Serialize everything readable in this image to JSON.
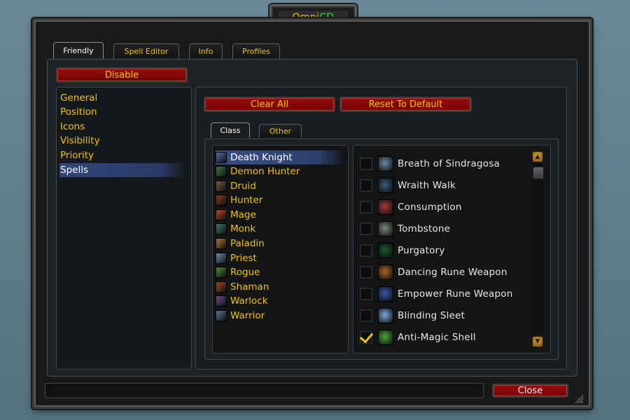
{
  "window": {
    "title_part1": "Omni",
    "title_part2": "CD"
  },
  "top_tabs": [
    {
      "label": "Friendly",
      "active": true
    },
    {
      "label": "Spell Editor",
      "active": false
    },
    {
      "label": "Info",
      "active": false
    },
    {
      "label": "Profiles",
      "active": false
    }
  ],
  "toolbar": {
    "disable_label": "Disable",
    "clear_all_label": "Clear All",
    "reset_label": "Reset To Default",
    "close_label": "Close"
  },
  "nav": {
    "items": [
      {
        "label": "General"
      },
      {
        "label": "Position"
      },
      {
        "label": "Icons"
      },
      {
        "label": "Visibility"
      },
      {
        "label": "Priority"
      },
      {
        "label": "Spells",
        "selected": true
      }
    ]
  },
  "sub_tabs": [
    {
      "label": "Class",
      "active": true
    },
    {
      "label": "Other",
      "active": false
    }
  ],
  "classes": [
    {
      "label": "Death Knight",
      "selected": true,
      "color": "#5a6fa8"
    },
    {
      "label": "Demon Hunter",
      "color": "#3c7a34"
    },
    {
      "label": "Druid",
      "color": "#7a5a3a"
    },
    {
      "label": "Hunter",
      "color": "#8a3a1c"
    },
    {
      "label": "Mage",
      "color": "#b54a1a"
    },
    {
      "label": "Monk",
      "color": "#3a7a6a"
    },
    {
      "label": "Paladin",
      "color": "#a87a2a"
    },
    {
      "label": "Priest",
      "color": "#6a8aa8"
    },
    {
      "label": "Rogue",
      "color": "#4a8a3a"
    },
    {
      "label": "Shaman",
      "color": "#a8461a"
    },
    {
      "label": "Warlock",
      "color": "#6a4a8a"
    },
    {
      "label": "Warrior",
      "color": "#5a7a9a"
    }
  ],
  "spells": [
    {
      "label": "Breath of Sindragosa",
      "checked": false,
      "color": "#6a8aa8"
    },
    {
      "label": "Wraith Walk",
      "checked": false,
      "color": "#3a5a7a"
    },
    {
      "label": "Consumption",
      "checked": false,
      "color": "#a83a3a"
    },
    {
      "label": "Tombstone",
      "checked": false,
      "color": "#7a8a7a"
    },
    {
      "label": "Purgatory",
      "checked": false,
      "color": "#1a5a2a"
    },
    {
      "label": "Dancing Rune Weapon",
      "checked": false,
      "color": "#a8642a"
    },
    {
      "label": "Empower Rune Weapon",
      "checked": false,
      "color": "#3a5aa8"
    },
    {
      "label": "Blinding Sleet",
      "checked": false,
      "color": "#7aaad8"
    },
    {
      "label": "Anti-Magic Shell",
      "checked": true,
      "color": "#4aa83a"
    }
  ],
  "colors": {
    "accent_gold": "#f2c400",
    "button_red": "#8a0a0a",
    "selection_blue": "#33467a"
  }
}
